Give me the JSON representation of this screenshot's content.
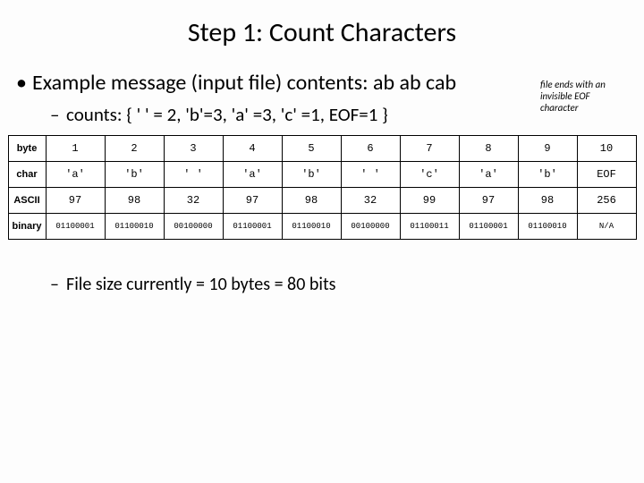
{
  "title": "Step 1: Count Characters",
  "bullet1": "Example message (input file) contents: ab ab cab",
  "bullet2": "counts:  { '  ' = 2, 'b'=3, 'a' =3, 'c' =1, EOF=1 }",
  "bullet3": "File size currently = 10 bytes = 80 bits",
  "eof_note_l1": "file ends with an",
  "eof_note_l2": "invisible EOF",
  "eof_note_l3": "character",
  "row_headers": {
    "byte": "byte",
    "char": "char",
    "ascii": "ASCII",
    "binary": "binary"
  },
  "cols": [
    "1",
    "2",
    "3",
    "4",
    "5",
    "6",
    "7",
    "8",
    "9",
    "10"
  ],
  "chart_data": {
    "type": "table",
    "title": "Character byte table",
    "columns": [
      "byte",
      "char",
      "ASCII",
      "binary"
    ],
    "rows": [
      {
        "byte": "1",
        "char": "'a'",
        "ASCII": "97",
        "binary": "01100001"
      },
      {
        "byte": "2",
        "char": "'b'",
        "ASCII": "98",
        "binary": "01100010"
      },
      {
        "byte": "3",
        "char": "' '",
        "ASCII": "32",
        "binary": "00100000"
      },
      {
        "byte": "4",
        "char": "'a'",
        "ASCII": "97",
        "binary": "01100001"
      },
      {
        "byte": "5",
        "char": "'b'",
        "ASCII": "98",
        "binary": "01100010"
      },
      {
        "byte": "6",
        "char": "' '",
        "ASCII": "32",
        "binary": "00100000"
      },
      {
        "byte": "7",
        "char": "'c'",
        "ASCII": "99",
        "binary": "01100011"
      },
      {
        "byte": "8",
        "char": "'a'",
        "ASCII": "97",
        "binary": "01100001"
      },
      {
        "byte": "9",
        "char": "'b'",
        "ASCII": "98",
        "binary": "01100010"
      },
      {
        "byte": "10",
        "char": "EOF",
        "ASCII": "256",
        "binary": "N/A"
      }
    ]
  }
}
